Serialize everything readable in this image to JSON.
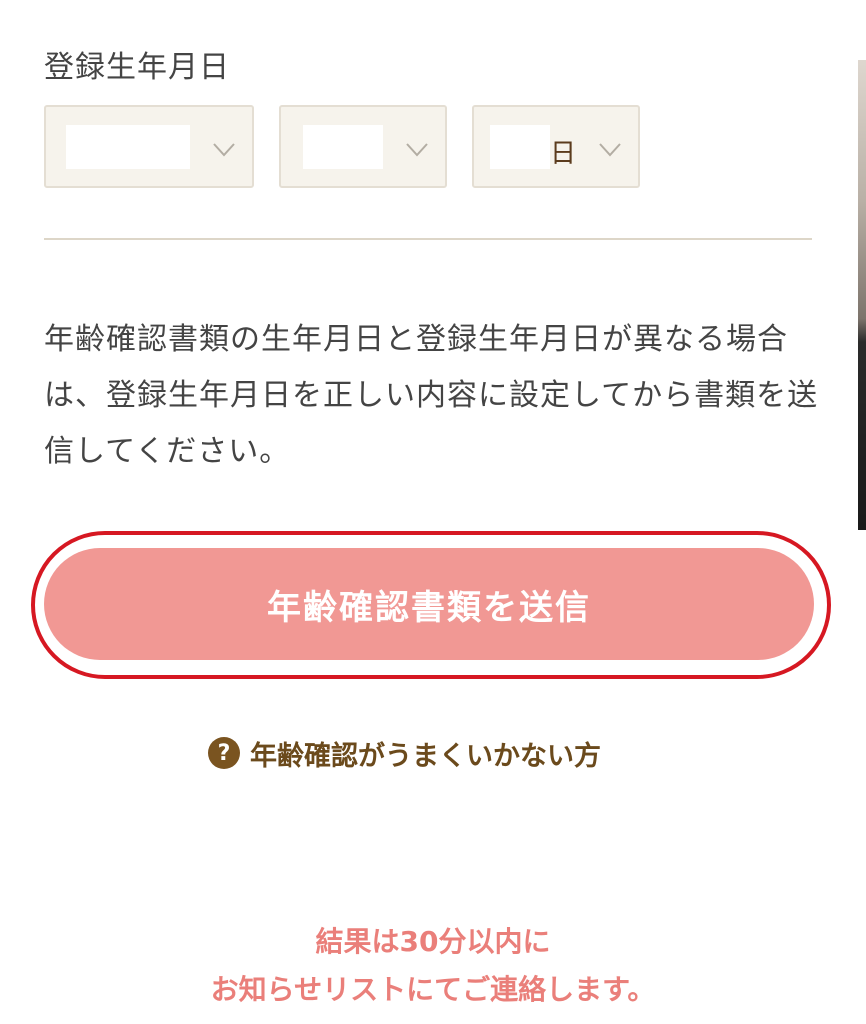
{
  "birthdate": {
    "label": "登録生年月日",
    "day_suffix": "日"
  },
  "notice": "年齢確認書類の生年月日と登録生年月日が異なる場合は、登録生年月日を正しい内容に設定してから書類を送信してください。",
  "submit_button": "年齢確認書類を送信",
  "help": {
    "icon": "?",
    "label": "年齢確認がうまくいかない方"
  },
  "result_note": {
    "line1": "結果は30分以内に",
    "line2": "お知らせリストにてご連絡します。"
  },
  "colors": {
    "button": "#f19894",
    "highlight": "#d61822",
    "help_text": "#6b4a1c",
    "result_text": "#ea7f7a"
  }
}
